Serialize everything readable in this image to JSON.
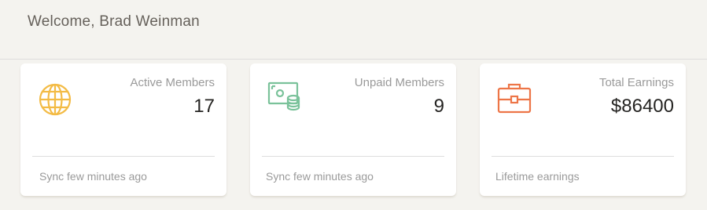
{
  "header": {
    "welcome_text": "Welcome, Brad Weinman"
  },
  "cards": [
    {
      "icon": "globe-icon",
      "icon_color": "#f3bb45",
      "label": "Active Members",
      "value": "17",
      "footer": "Sync few minutes ago"
    },
    {
      "icon": "money-coins-icon",
      "icon_color": "#7ac29a",
      "label": "Unpaid Members",
      "value": "9",
      "footer": "Sync few minutes ago"
    },
    {
      "icon": "briefcase-icon",
      "icon_color": "#eb5e28",
      "label": "Total Earnings",
      "value": "$86400",
      "footer": "Lifetime earnings"
    }
  ],
  "colors": {
    "background": "#f4f3ef",
    "card": "#ffffff",
    "text_dark": "#252422",
    "text_muted": "#9a9a9a",
    "header_text": "#66615b"
  }
}
